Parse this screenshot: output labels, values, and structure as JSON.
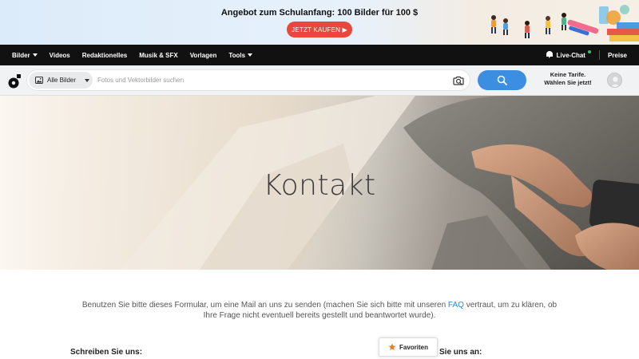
{
  "promo": {
    "title": "Angebot zum Schulanfang: 100 Bilder für 100 $",
    "button_label": "JETZT KAUFEN ▶"
  },
  "nav": {
    "items": [
      {
        "label": "Bilder",
        "has_dropdown": true
      },
      {
        "label": "Videos",
        "has_dropdown": false
      },
      {
        "label": "Redaktionelles",
        "has_dropdown": false
      },
      {
        "label": "Musik & SFX",
        "has_dropdown": false
      },
      {
        "label": "Vorlagen",
        "has_dropdown": false
      },
      {
        "label": "Tools",
        "has_dropdown": true
      }
    ],
    "live_chat": "Live-Chat",
    "pricing": "Preise"
  },
  "search": {
    "filter_label": "Alle Bilder",
    "placeholder": "Fotos und Vektorbilder suchen",
    "value": ""
  },
  "plans": {
    "line1": "Keine Tarife.",
    "line2": "Wählen Sie jetzt!"
  },
  "hero": {
    "title": "Kontakt"
  },
  "content": {
    "intro_before": "Benutzen Sie bitte dieses Formular, um eine Mail an uns zu senden (machen Sie sich bitte mit unseren ",
    "intro_link": "FAQ",
    "intro_after": " vertraut, um zu klären, ob Ihre Frage nicht eventuell bereits gestellt und beantwortet wurde).",
    "section_left": "Schreiben Sie uns:",
    "section_right": "Sie uns an:"
  },
  "favorites": {
    "label": "Favoriten"
  },
  "colors": {
    "accent_blue": "#3c8ee0",
    "promo_red": "#e8473d",
    "nav_bg": "#111111",
    "link": "#2a86d6"
  },
  "icons": [
    "logo-icon",
    "image-icon",
    "camera-search-icon",
    "search-icon",
    "live-chat-icon",
    "star-icon",
    "user-avatar-icon"
  ]
}
